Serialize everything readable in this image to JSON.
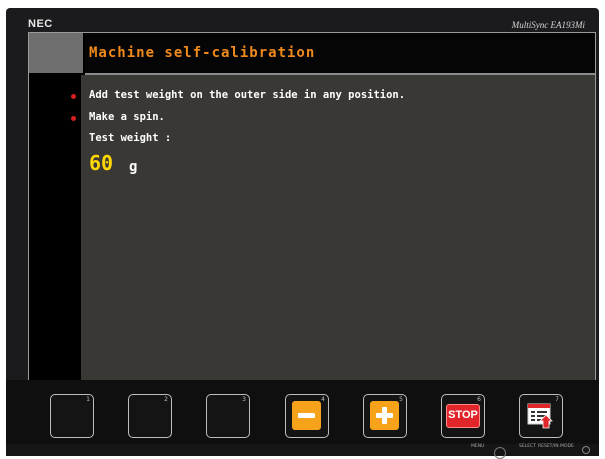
{
  "monitor": {
    "brand": "NEC",
    "model": "MultiSync EA193Mi"
  },
  "screen": {
    "title": "Machine self-calibration",
    "instructions": [
      "Add test weight on the outer side in any position.",
      "Make a spin."
    ],
    "test_weight_label": "Test weight :",
    "test_weight_value": "60",
    "test_weight_unit": "g"
  },
  "softkeys": [
    {
      "number": "1",
      "function": ""
    },
    {
      "number": "2",
      "function": ""
    },
    {
      "number": "3",
      "function": ""
    },
    {
      "number": "4",
      "function": "minus-icon"
    },
    {
      "number": "5",
      "function": "plus-icon"
    },
    {
      "number": "6",
      "label": "STOP"
    },
    {
      "number": "7",
      "function": "exit-to-menu-icon"
    }
  ],
  "bezel_controls": {
    "menu": "MENU",
    "select": "SELECT",
    "reset": "RESET/IN MODE"
  },
  "colors": {
    "title_text": "#f08a1c",
    "value_text": "#ffd800",
    "bullet": "#d81e1e",
    "key_accent": "#f7a21b",
    "stop_red": "#e0262a"
  }
}
